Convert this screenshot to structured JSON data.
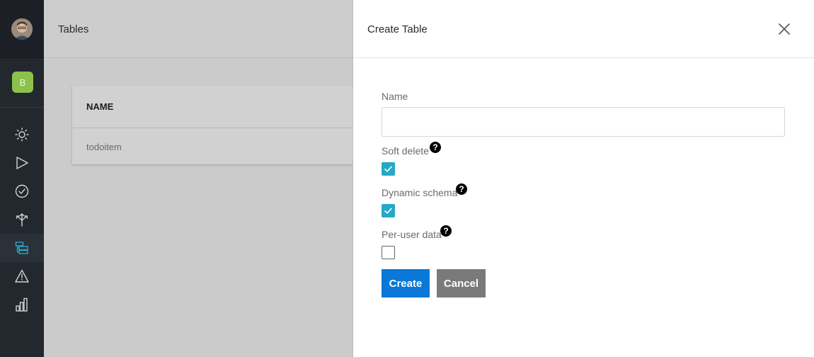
{
  "sidebar": {
    "app_badge": "B",
    "nav_icons": [
      "sun-icon",
      "play-icon",
      "check-circle-icon",
      "split-arrows-icon",
      "tables-icon",
      "warning-icon",
      "bar-chart-icon"
    ],
    "active_item": "tables-icon"
  },
  "main": {
    "title": "Tables",
    "table": {
      "header_name": "NAME",
      "rows": [
        "todoitem"
      ]
    }
  },
  "panel": {
    "title": "Create Table",
    "name_label": "Name",
    "name_value": "",
    "soft_delete": {
      "label": "Soft delete",
      "checked": true
    },
    "dynamic_schema": {
      "label": "Dynamic schema",
      "checked": true
    },
    "per_user_data": {
      "label": "Per-user data",
      "checked": false
    },
    "help_glyph": "?",
    "create_label": "Create",
    "cancel_label": "Cancel"
  },
  "colors": {
    "accent": "#0a78d6",
    "checkbox": "#26a9c6",
    "badge": "#8bc34a",
    "sidebar": "#23282e"
  }
}
